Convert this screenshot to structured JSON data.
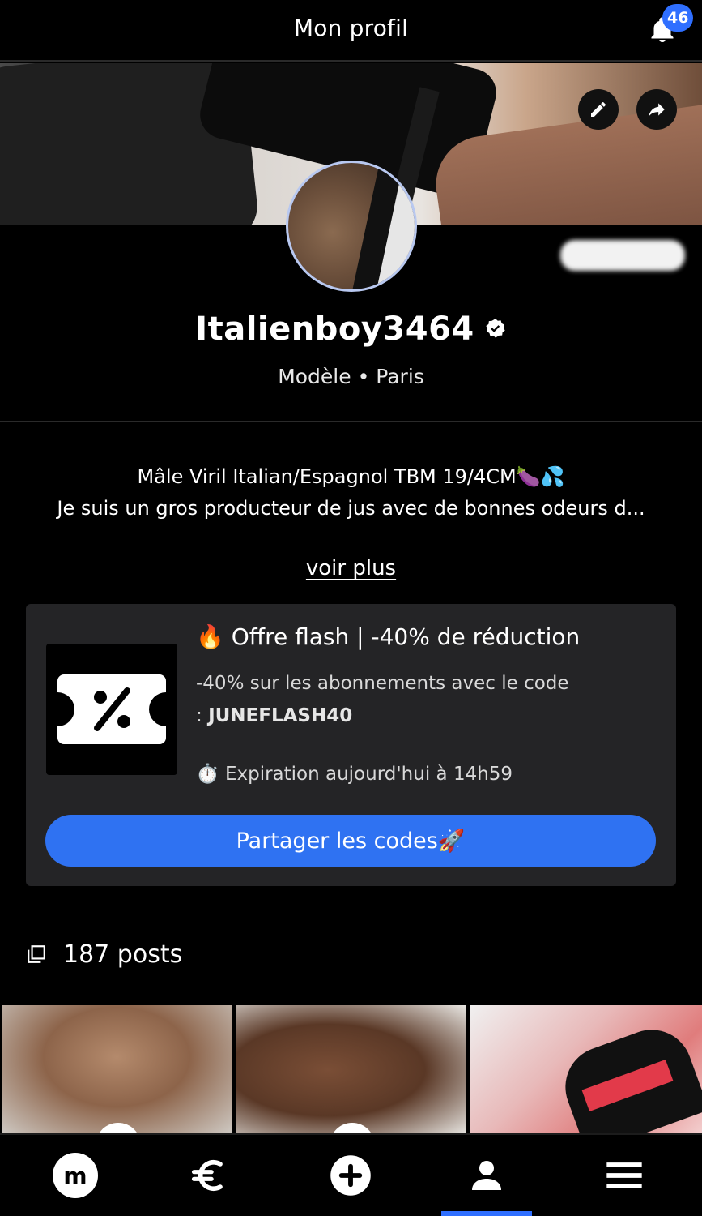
{
  "header": {
    "title": "Mon profil",
    "notifications_count": "46"
  },
  "profile": {
    "username": "Italienboy3464",
    "subtitle": "Modèle • Paris",
    "bio_line1": "Mâle Viril Italian/Espagnol TBM 19/4CM🍆💦",
    "bio_line2": "Je suis un gros producteur de jus avec de bonnes odeurs d...",
    "voir_plus": "voir plus"
  },
  "offer": {
    "title": "🔥 Offre flash | -40% de réduction",
    "desc_prefix": "-40% sur les abonnements avec le code",
    "desc_code_prefix": ": ",
    "code": "JUNEFLASH40",
    "expiration": "⏱️ Expiration aujourd'hui à 14h59",
    "share_button": "Partager les codes🚀"
  },
  "posts": {
    "count_label": "187 posts"
  },
  "nav": {
    "items": [
      "home",
      "earnings",
      "create",
      "profile",
      "menu"
    ],
    "active": "profile",
    "logo_letter": "m"
  },
  "colors": {
    "accent": "#2f6fff",
    "button": "#2f72f2",
    "card": "#242426",
    "background": "#000000"
  }
}
